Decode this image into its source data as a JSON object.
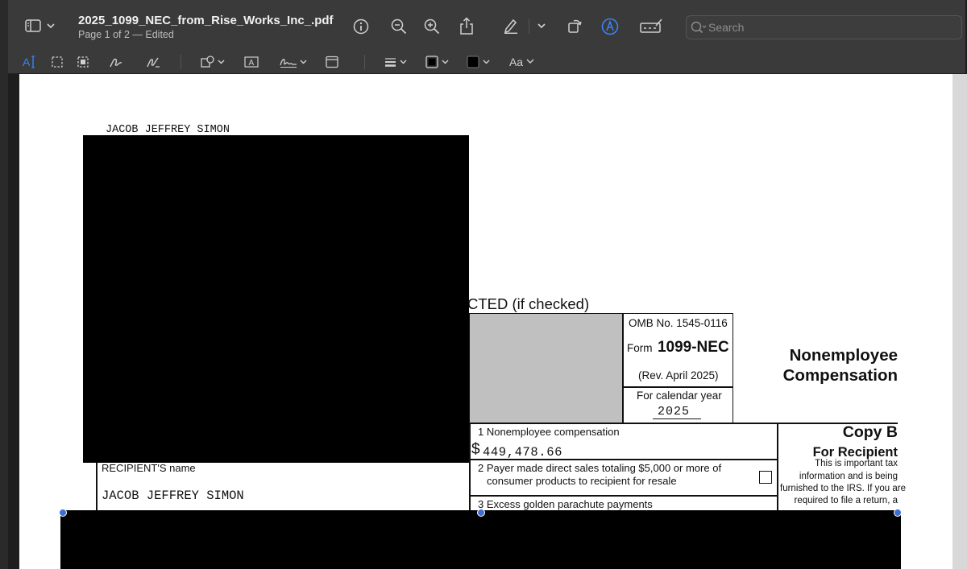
{
  "window": {
    "title": "2025_1099_NEC_from_Rise_Works_Inc_.pdf",
    "subtitle": "Page 1 of 2 — Edited",
    "search_placeholder": "Search",
    "markup_text_style_label": "Aa"
  },
  "document": {
    "payer_name_top": "JACOB JEFFREY SIMON",
    "corrected_fragment": "CTED (if checked)",
    "omb": "OMB No. 1545-0116",
    "form_prefix": "Form",
    "form_number": "1099-NEC",
    "rev": "(Rev. April 2025)",
    "calendar_year_label": "For calendar year",
    "calendar_year": "2025",
    "heading_line1": "Nonemployee",
    "heading_line2": "Compensation",
    "box1_label": "1 Nonemployee compensation",
    "box1_currency": "$",
    "box1_value": "449,478.66",
    "recipient_label": "RECIPIENT'S name",
    "recipient_name": "JACOB JEFFREY SIMON",
    "box2_line1": "2 Payer made direct sales totaling $5,000 or more of",
    "box2_line2": "consumer products to recipient for resale",
    "box3_label": "3 Excess golden parachute payments",
    "copy_title": "Copy B",
    "copy_sub": "For Recipient",
    "notice_line1": "This is important tax",
    "notice_line2": "information and is being",
    "notice_line3": "furnished to the IRS. If you are",
    "notice_line4": "required to file a return, a"
  },
  "icons": [
    "sidebar-icon",
    "chevron-down-icon",
    "info-icon",
    "zoom-out-icon",
    "zoom-in-icon",
    "share-icon",
    "highlight-pen-icon",
    "rotate-icon",
    "markup-icon",
    "annotate-icon",
    "search-icon",
    "text-selection-icon",
    "rect-selection-icon",
    "smart-lasso-icon",
    "sketch-icon",
    "draw-icon",
    "shapes-icon",
    "text-box-icon",
    "signature-icon",
    "note-icon",
    "line-style-icon",
    "border-color-icon",
    "fill-color-icon",
    "text-style-icon"
  ],
  "colors": {
    "accent": "#3b6fd6",
    "toolbar": "#3a3a3a",
    "grey_box": "#c0c0c0"
  }
}
